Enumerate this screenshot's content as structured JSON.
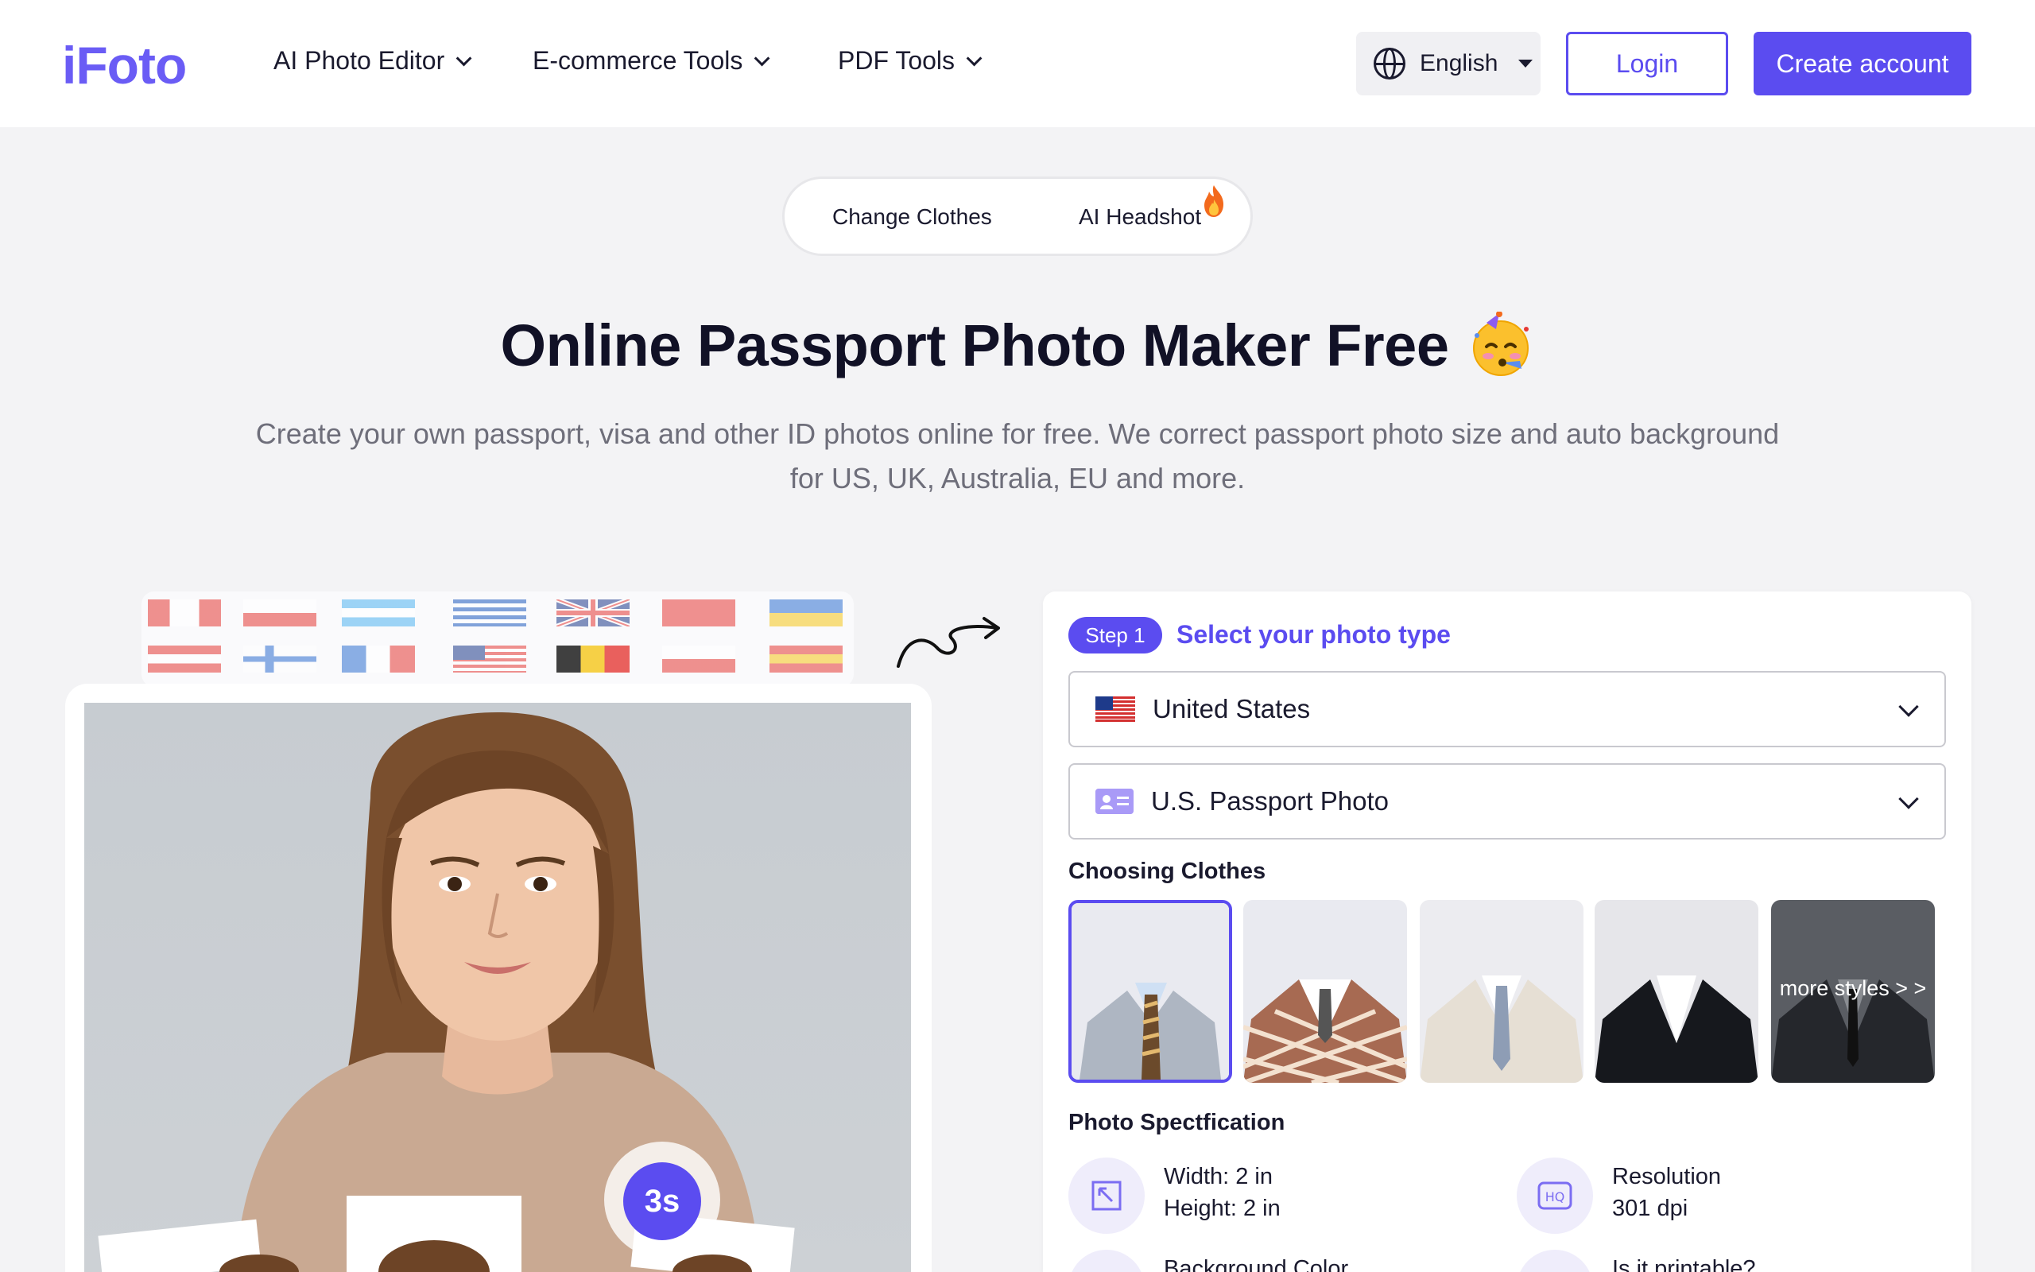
{
  "header": {
    "logo": "iFoto",
    "nav": [
      {
        "label": "AI Photo Editor"
      },
      {
        "label": "E-commerce Tools"
      },
      {
        "label": "PDF Tools"
      }
    ],
    "language": "English",
    "login_label": "Login",
    "create_account_label": "Create account"
  },
  "tabs": {
    "change_clothes": "Change Clothes",
    "ai_headshot": "AI Headshot"
  },
  "hero": {
    "title": "Online Passport Photo Maker Free",
    "subtitle_line1": "Create your own passport, visa and other ID photos online for free. We correct passport photo size and auto background",
    "subtitle_line2": "for US, UK, Australia, EU and more."
  },
  "showcase": {
    "timer": "3s"
  },
  "panel": {
    "step_badge": "Step 1",
    "step_title": "Select your photo type",
    "country": "United States",
    "photo_type": "U.S. Passport Photo",
    "clothes_label": "Choosing Clothes",
    "more_styles": "more styles > >",
    "spec_label": "Photo Spectfication",
    "spec": {
      "width": "Width: 2 in",
      "height": "Height: 2 in",
      "resolution_label": "Resolution",
      "resolution_value": "301 dpi",
      "background_color": "Background Color",
      "printable": "Is it printable?"
    }
  },
  "colors": {
    "brand": "#5b4cf0",
    "page_bg": "#f3f3f5",
    "text": "#1a1a2e"
  },
  "icons": [
    "globe-icon",
    "caret-down-icon",
    "chevron-down-icon",
    "flame-icon",
    "party-emoji-icon",
    "curly-arrow-icon",
    "us-flag-icon",
    "id-card-icon",
    "resize-icon",
    "hq-icon"
  ]
}
